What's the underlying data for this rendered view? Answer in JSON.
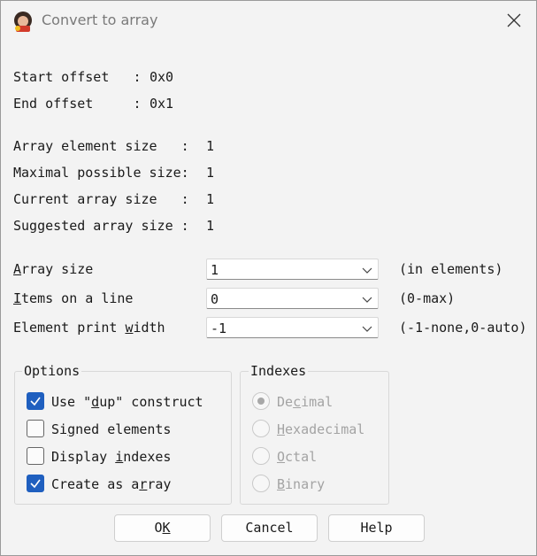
{
  "window": {
    "title": "Convert to array",
    "app_icon": "app-logo-icon",
    "close_icon": "close-icon"
  },
  "info": {
    "start_offset_label": "Start offset   :",
    "start_offset_value": "0x0",
    "end_offset_label": "End offset     :",
    "end_offset_value": "0x1",
    "array_element_size_label": "Array element size   :",
    "array_element_size_value": "1",
    "maximal_possible_size_label": "Maximal possible size:",
    "maximal_possible_size_value": "1",
    "current_array_size_label": "Current array size   :",
    "current_array_size_value": "1",
    "suggested_array_size_label": "Suggested array size :",
    "suggested_array_size_value": "1"
  },
  "fields": {
    "array_size": {
      "label_u": "A",
      "label_rest": "rray size",
      "value": "1",
      "hint": "(in elements)"
    },
    "items_on_line": {
      "label_u": "I",
      "label_rest": "tems on a line",
      "value": "0",
      "hint": "(0-max)"
    },
    "element_print_width": {
      "label_pre": "Element print ",
      "label_u": "w",
      "label_rest": "idth",
      "value": "-1",
      "hint": "(-1-none,0-auto)"
    }
  },
  "options": {
    "title": "Options",
    "use_dup": {
      "pre": "Use \"",
      "u": "d",
      "rest": "up\" construct",
      "checked": true
    },
    "signed": {
      "pre": "Si",
      "u": "g",
      "rest": "ned elements",
      "checked": false
    },
    "display_indexes": {
      "pre": "Display ",
      "u": "i",
      "rest": "ndexes",
      "checked": false
    },
    "create_array": {
      "pre": "Create as a",
      "u": "r",
      "rest": "ray",
      "checked": true
    }
  },
  "indexes": {
    "title": "Indexes",
    "decimal": {
      "pre": "De",
      "u": "c",
      "rest": "imal",
      "selected": true
    },
    "hexadecimal": {
      "pre": "",
      "u": "H",
      "rest": "exadecimal",
      "selected": false
    },
    "octal": {
      "pre": "",
      "u": "O",
      "rest": "ctal",
      "selected": false
    },
    "binary": {
      "pre": "",
      "u": "B",
      "rest": "inary",
      "selected": false
    }
  },
  "buttons": {
    "ok": {
      "pre": "O",
      "u": "K",
      "rest": ""
    },
    "cancel": "Cancel",
    "help": "Help"
  },
  "colors": {
    "accent": "#1f5fbf",
    "background": "#f3f3f3",
    "disabled_text": "#a3a3a3"
  }
}
